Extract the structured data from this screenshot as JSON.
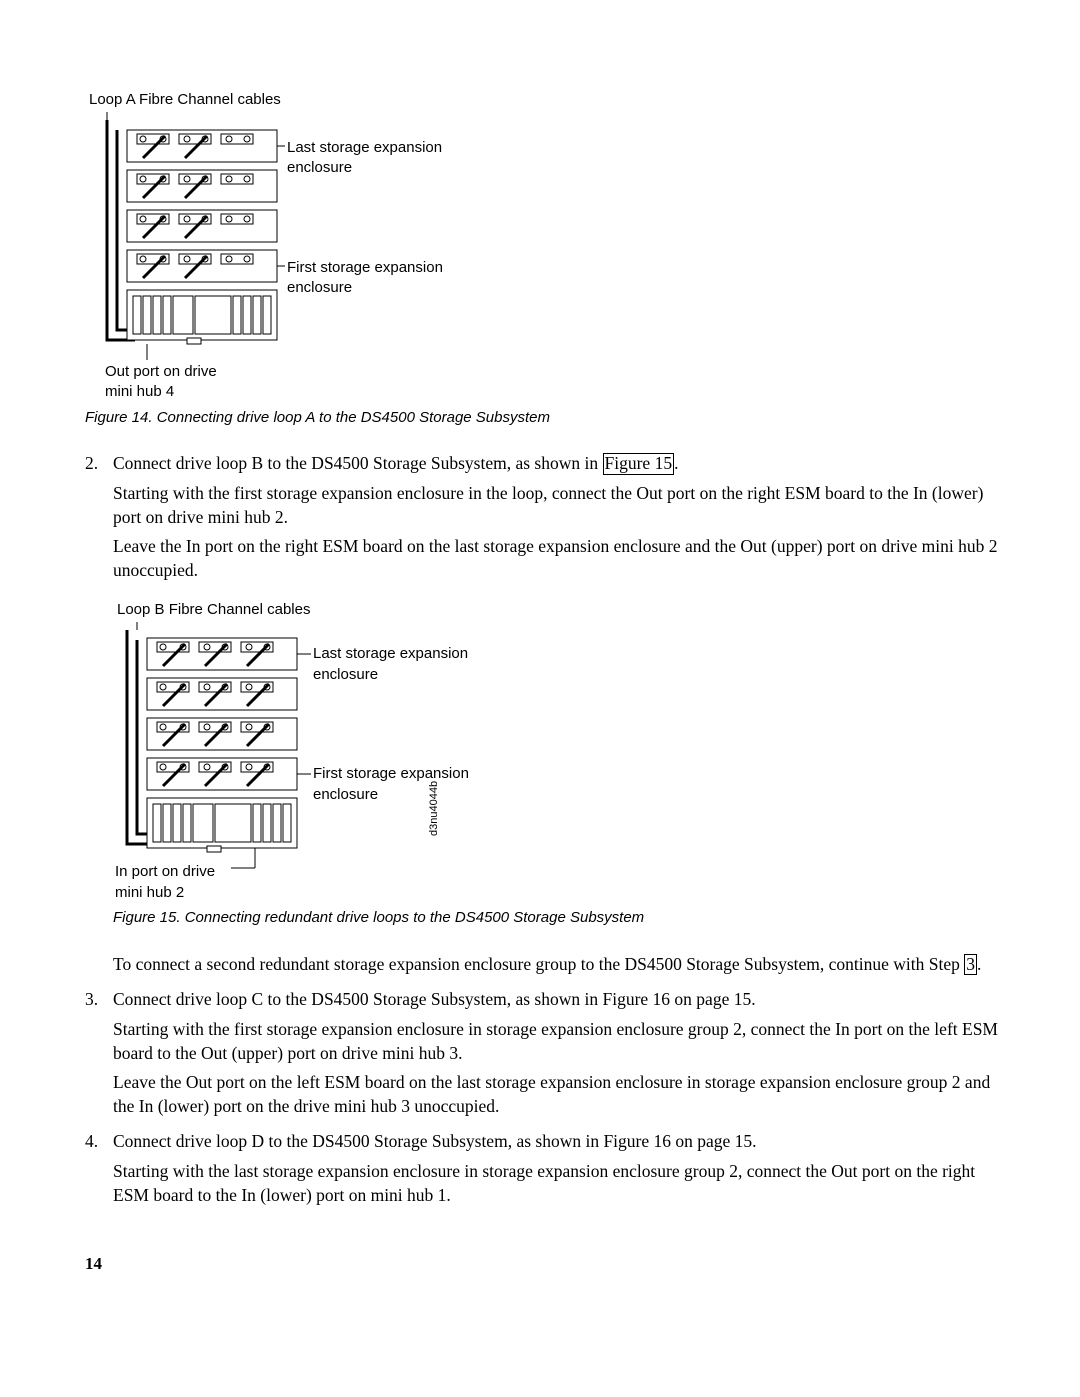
{
  "figure14": {
    "topLabel": "Loop A Fibre Channel cables",
    "lastLabel": "Last storage expansion enclosure",
    "firstLabel": "First storage expansion enclosure",
    "outLabel1": "Out port on drive",
    "outLabel2": "mini hub 4",
    "caption": "Figure 14. Connecting drive loop A to the DS4500 Storage Subsystem"
  },
  "step2": {
    "num": "2.",
    "p1a": "Connect drive loop B to the DS4500 Storage Subsystem, as shown in ",
    "link": "Figure 15",
    "p1b": ".",
    "p2": "Starting with the first storage expansion enclosure in the loop, connect the Out port on the right ESM board to the In (lower) port on drive mini hub 2.",
    "p3": "Leave the In port on the right ESM board on the last storage expansion enclosure and the Out (upper) port on drive mini hub 2 unoccupied."
  },
  "figure15": {
    "topLabel": "Loop B Fibre Channel cables",
    "lastLabel": "Last storage expansion enclosure",
    "firstLabel": "First storage expansion enclosure",
    "inLabel1": "In port on drive",
    "inLabel2": "mini hub 2",
    "imgcode": "d3nu4044b",
    "caption": "Figure 15. Connecting redundant drive loops to the DS4500 Storage Subsystem"
  },
  "afterFig15": {
    "p1a": "To connect a second redundant storage expansion enclosure group to the DS4500 Storage Subsystem, continue with Step ",
    "link": "3",
    "p1b": "."
  },
  "step3": {
    "num": "3.",
    "p1": "Connect drive loop C to the DS4500 Storage Subsystem, as shown in Figure 16 on page 15.",
    "p2": "Starting with the first storage expansion enclosure in storage expansion enclosure group 2, connect the In port on the left ESM board to the Out (upper) port on drive mini hub 3.",
    "p3": "Leave the Out port on the left ESM board on the last storage expansion enclosure in storage expansion enclosure group 2 and the In (lower) port on the drive mini hub 3 unoccupied."
  },
  "step4": {
    "num": "4.",
    "p1": "Connect drive loop D to the DS4500 Storage Subsystem, as shown in Figure 16 on page 15.",
    "p2": "Starting with the last storage expansion enclosure in storage expansion enclosure group 2, connect the Out port on the right ESM board to the In (lower) port on mini hub 1."
  },
  "pageNumber": "14"
}
